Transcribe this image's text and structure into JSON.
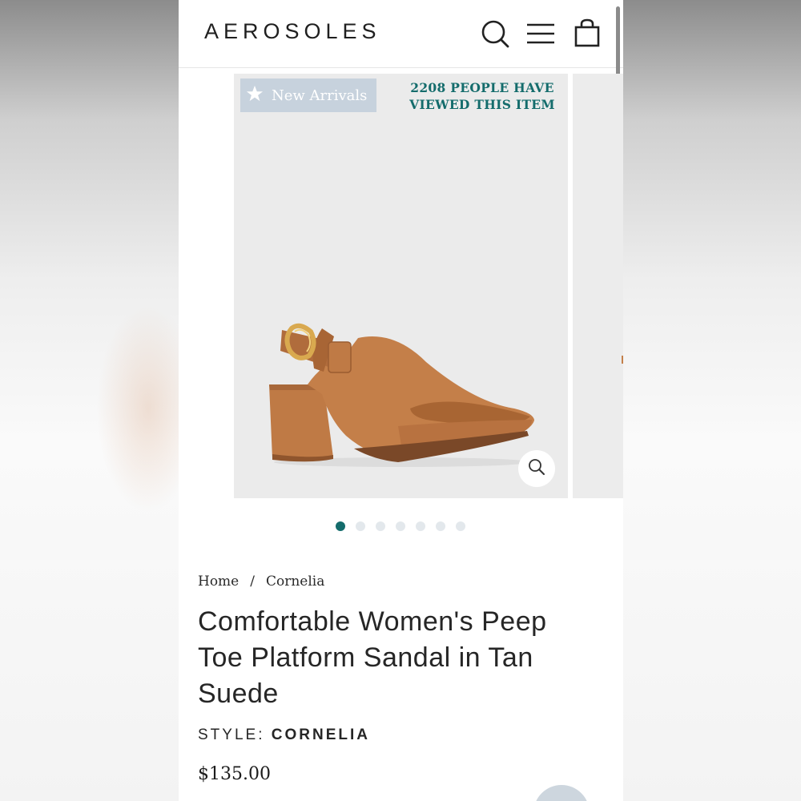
{
  "header": {
    "logo": "AEROSOLES",
    "icons": [
      "search-icon",
      "menu-icon",
      "cart-icon"
    ]
  },
  "gallery": {
    "badge": "New Arrivals",
    "viewed_line1": "2208 PEOPLE HAVE",
    "viewed_line2": "VIEWED THIS ITEM",
    "slide_count": 7,
    "active_slide": 1
  },
  "breadcrumb": {
    "home": "Home",
    "separator": "/",
    "current": "Cornelia"
  },
  "product": {
    "title": "Comfortable Women's Peep Toe Platform Sandal in Tan Suede",
    "style_label": "STYLE:",
    "style_value": "CORNELIA",
    "price": "$135.00"
  },
  "colors": {
    "accent": "#146c6c",
    "badge_bg": "#c7d2dd",
    "shoe": "#bf7a45"
  }
}
